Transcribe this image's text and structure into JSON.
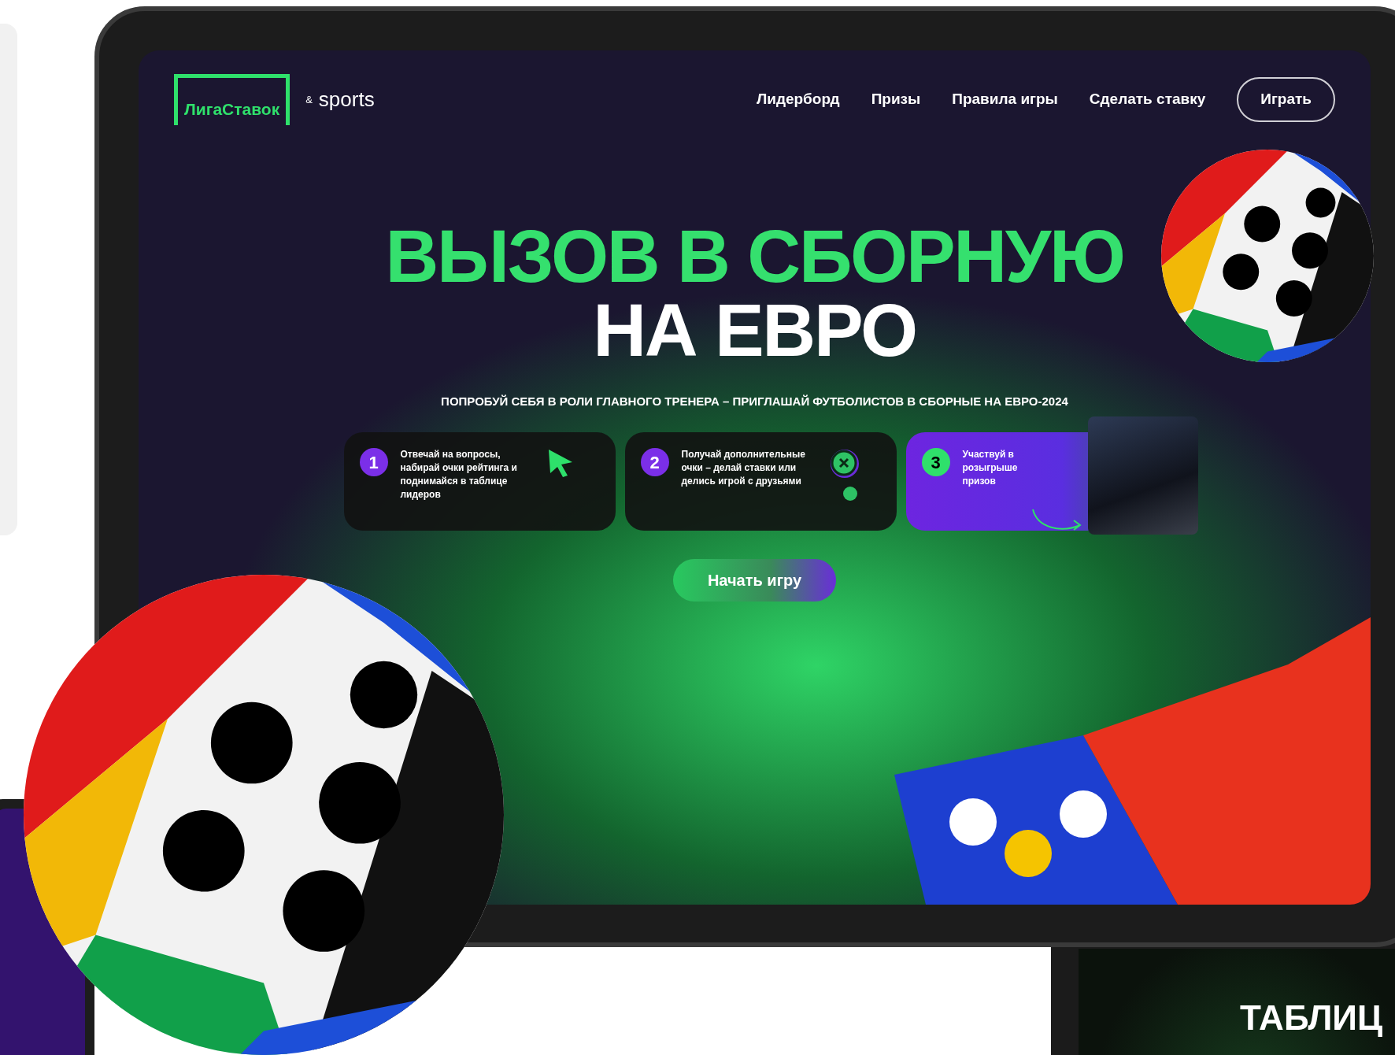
{
  "header": {
    "logo": "ЛигаСтавок",
    "amp": "&",
    "partner": "sports",
    "nav": [
      {
        "label": "Лидерборд"
      },
      {
        "label": "Призы"
      },
      {
        "label": "Правила игры"
      },
      {
        "label": "Сделать ставку"
      }
    ],
    "cta": "Играть"
  },
  "hero": {
    "headline": "ВЫЗОВ В СБОРНУЮ",
    "headline_second": "НА ЕВРО",
    "subtitle": "ПОПРОБУЙ СЕБЯ В РОЛИ ГЛАВНОГО ТРЕНЕРА – ПРИГЛАШАЙ ФУТБОЛИСТОВ В СБОРНЫЕ НА ЕВРО-2024"
  },
  "steps": [
    {
      "kind": "cursor",
      "number": "1",
      "text": "Отвечай на вопросы, набирай очки рейтинга и поднимайся в таблице лидеров"
    },
    {
      "kind": "coins",
      "number": "2",
      "text": "Получай дополнительные очки – делай ставки или делись игрой с друзьями"
    },
    {
      "kind": "prize",
      "number": "3",
      "text": "Участвуй в розыгрыше призов"
    }
  ],
  "start_button": "Начать игру",
  "second_device": {
    "heading": "ТАБЛИЦ"
  }
}
